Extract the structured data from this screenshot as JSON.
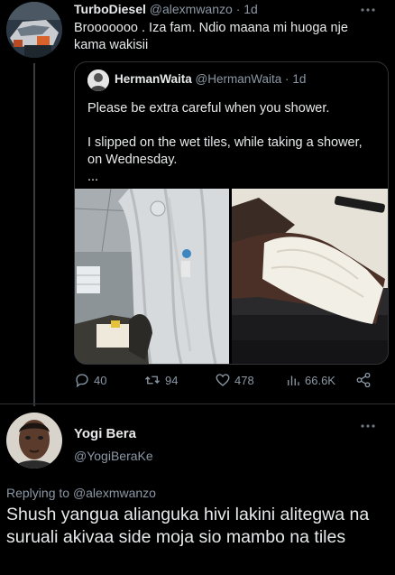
{
  "tweet": {
    "name": "TurboDiesel",
    "handle": "@alexmwanzo",
    "separator": "·",
    "time": "1d",
    "text": "Brooooooo . Iza fam. Ndio maana mi huoga nje kama wakisii",
    "more_icon": "more-horizontal-icon"
  },
  "quote": {
    "name": "HermanWaita",
    "handle": "@HermanWaita",
    "separator": "·",
    "time": "1d",
    "line1": "Please be extra careful when you shower.",
    "line2": "I slipped on the wet tiles, while taking a shower, on Wednesday.",
    "line3": "..."
  },
  "actions": {
    "replies": "40",
    "retweets": "94",
    "likes": "478",
    "views": "66.6K"
  },
  "reply": {
    "name": "Yogi Bera",
    "handle": "@YogiBeraKe",
    "replying_prefix": "Replying to",
    "replying_to": "@alexmwanzo",
    "text": "Shush yangua alianguka hivi lakini alitegwa na suruali akivaa side moja sio mambo na tiles"
  },
  "colors": {
    "background": "#000000",
    "text": "#e7e9ea",
    "muted": "#8b98a5",
    "border": "#2f3336"
  }
}
